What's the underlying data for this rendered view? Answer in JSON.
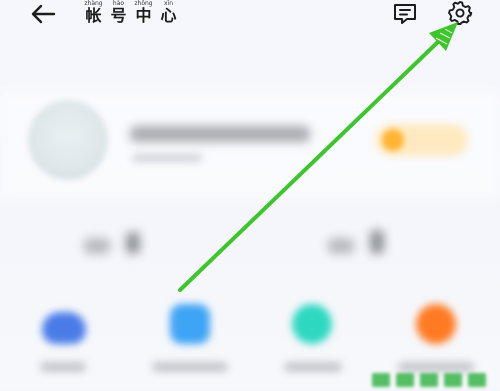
{
  "header": {
    "back_icon": "arrow-left-icon",
    "title_chars": [
      "帐",
      "号",
      "中",
      "心"
    ],
    "title_pinyin": [
      "zhàng",
      "hào",
      "zhōng",
      "xīn"
    ],
    "actions": [
      {
        "icon": "message-icon"
      },
      {
        "icon": "gear-icon"
      }
    ]
  },
  "profile": {
    "avatar": "avatar",
    "badge_color": "#ffb432"
  },
  "shortcuts": [
    {
      "icon": "cloud-icon",
      "color": "#4a7ce8"
    },
    {
      "icon": "square-icon",
      "color": "#3ea4f4"
    },
    {
      "icon": "circle-icon",
      "color": "#2ed8c0"
    },
    {
      "icon": "circle-icon",
      "color": "#ff7a22"
    }
  ],
  "annotation": {
    "type": "arrow",
    "color": "#3ec52c",
    "points_to": "gear-icon"
  },
  "colors": {
    "background": "#f5f7fd",
    "title_text": "#1c1c1c",
    "annotation_green": "#3ec52c"
  }
}
